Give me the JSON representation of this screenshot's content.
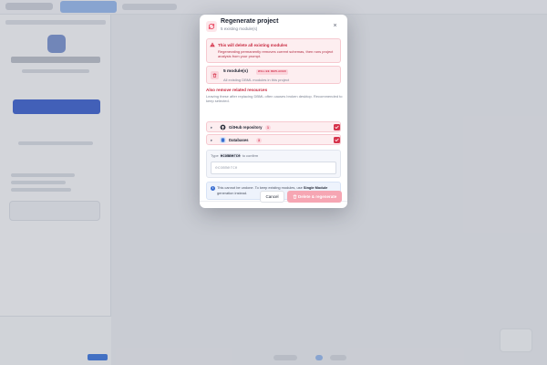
{
  "modal": {
    "title": "Regenerate project",
    "subtitle": "5 existing module(s)",
    "close_symbol": "×",
    "warning": {
      "title": "This will delete all existing modules",
      "text": "Regenerating permanently removes current schemas, then runs project analysis from your prompt."
    },
    "modules": {
      "count": "5 module(s)",
      "badge": "WILL BE REPLACED",
      "description": "All existing DBML modules in this project"
    },
    "related": {
      "title": "Also remove related resources",
      "description": "Leaving these after replacing DBML often causes broken desktop. Recommended to keep selected.",
      "items": [
        {
          "label": "GitHub repository",
          "count": "1",
          "icon": "github-icon",
          "checked": true
        },
        {
          "label": "Databases",
          "count": "3",
          "icon": "database-icon",
          "checked": true
        }
      ]
    },
    "confirm": {
      "label_prefix": "Type",
      "keyword": "ecommerce",
      "label_suffix": "to confirm",
      "placeholder": "ecommerce",
      "value": ""
    },
    "info": {
      "text_before": "This cannot be undone. To keep existing modules, use",
      "emphasis": "Single Module",
      "text_after": "generation instead."
    },
    "actions": {
      "cancel_label": "Cancel",
      "confirm_label": "Delete & regenerate"
    }
  },
  "colors": {
    "danger": "#d6344c",
    "danger_light": "#fdeef0",
    "info": "#3b6fd1",
    "backdrop": "#e9ebef"
  }
}
